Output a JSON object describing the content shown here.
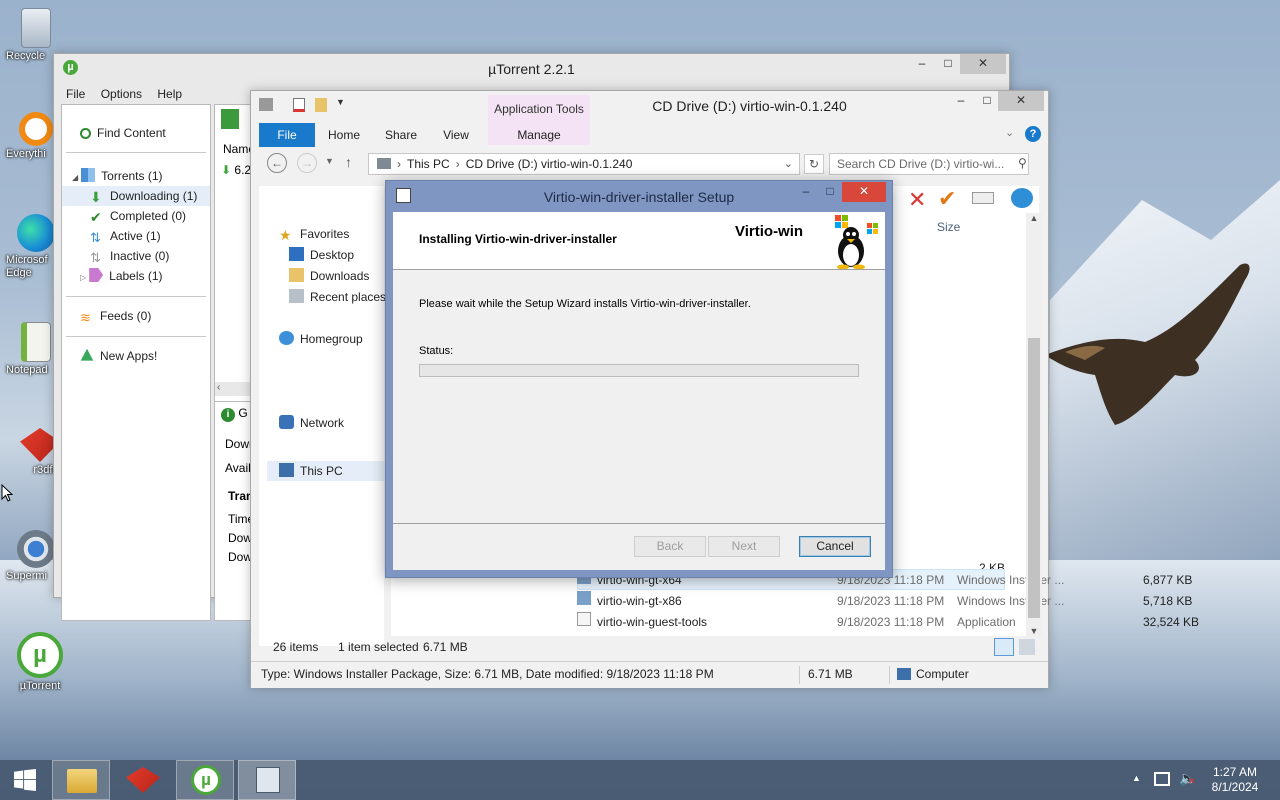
{
  "desktop": {
    "icons": [
      {
        "label": "Recycle"
      },
      {
        "label": "Everythi"
      },
      {
        "label": "Microsof Edge"
      },
      {
        "label": "Notepad"
      },
      {
        "label": "r3dfox"
      },
      {
        "label": "Supermi"
      },
      {
        "label": "µTorrent"
      }
    ]
  },
  "utorrent": {
    "title": "µTorrent 2.2.1",
    "menu": [
      "File",
      "Options",
      "Help"
    ],
    "sidebar": {
      "find_content": "Find Content",
      "torrents": "Torrents (1)",
      "downloading": "Downloading (1)",
      "completed": "Completed (0)",
      "active": "Active (1)",
      "inactive": "Inactive (0)",
      "labels": "Labels (1)",
      "feeds": "Feeds (0)",
      "new_apps": "New Apps!"
    },
    "list_header": "Name",
    "list_row": "6.2",
    "info": {
      "general_tab": "G",
      "down": "Down",
      "avail": "Avail",
      "transfer": "Tran",
      "time": "Time",
      "dow1": "Dow",
      "dow2": "Dow"
    }
  },
  "explorer": {
    "title": "CD Drive (D:) virtio-win-0.1.240",
    "ribbon_group": "Application Tools",
    "tabs": [
      "File",
      "Home",
      "Share",
      "View",
      "Manage"
    ],
    "address": [
      "This PC",
      "CD Drive (D:) virtio-win-0.1.240"
    ],
    "search_placeholder": "Search CD Drive (D:) virtio-wi...",
    "nav": {
      "favorites": "Favorites",
      "desktop": "Desktop",
      "downloads": "Downloads",
      "recent": "Recent places",
      "homegroup": "Homegroup",
      "this_pc": "This PC",
      "network": "Network"
    },
    "col_size": "Size",
    "partial_row": {
      "type": "t",
      "size": "2 KB"
    },
    "files": [
      {
        "name": "virtio-win-gt-x64",
        "date": "9/18/2023 11:18 PM",
        "type": "Windows Installer ...",
        "size": "6,877 KB"
      },
      {
        "name": "virtio-win-gt-x86",
        "date": "9/18/2023 11:18 PM",
        "type": "Windows Installer ...",
        "size": "5,718 KB"
      },
      {
        "name": "virtio-win-guest-tools",
        "date": "9/18/2023 11:18 PM",
        "type": "Application",
        "size": "32,524 KB"
      }
    ],
    "status": {
      "items": "26 items",
      "selected": "1 item selected",
      "selected_size": "6.71 MB"
    },
    "details": {
      "text": "Type: Windows Installer Package, Size: 6.71 MB, Date modified: 9/18/2023 11:18 PM",
      "size": "6.71 MB",
      "location": "Computer"
    }
  },
  "setup": {
    "title": "Virtio-win-driver-installer Setup",
    "heading": "Installing Virtio-win-driver-installer",
    "brand": "Virtio-win",
    "message": "Please wait while the Setup Wizard installs Virtio-win-driver-installer.",
    "status_label": "Status:",
    "progress": 0,
    "buttons": {
      "back": "Back",
      "next": "Next",
      "cancel": "Cancel"
    }
  },
  "taskbar": {
    "time": "1:27 AM",
    "date": "8/1/2024"
  },
  "colors": {
    "accent": "#1979ca",
    "dialog_frame": "#8096c2",
    "close_red": "#d9463a"
  }
}
